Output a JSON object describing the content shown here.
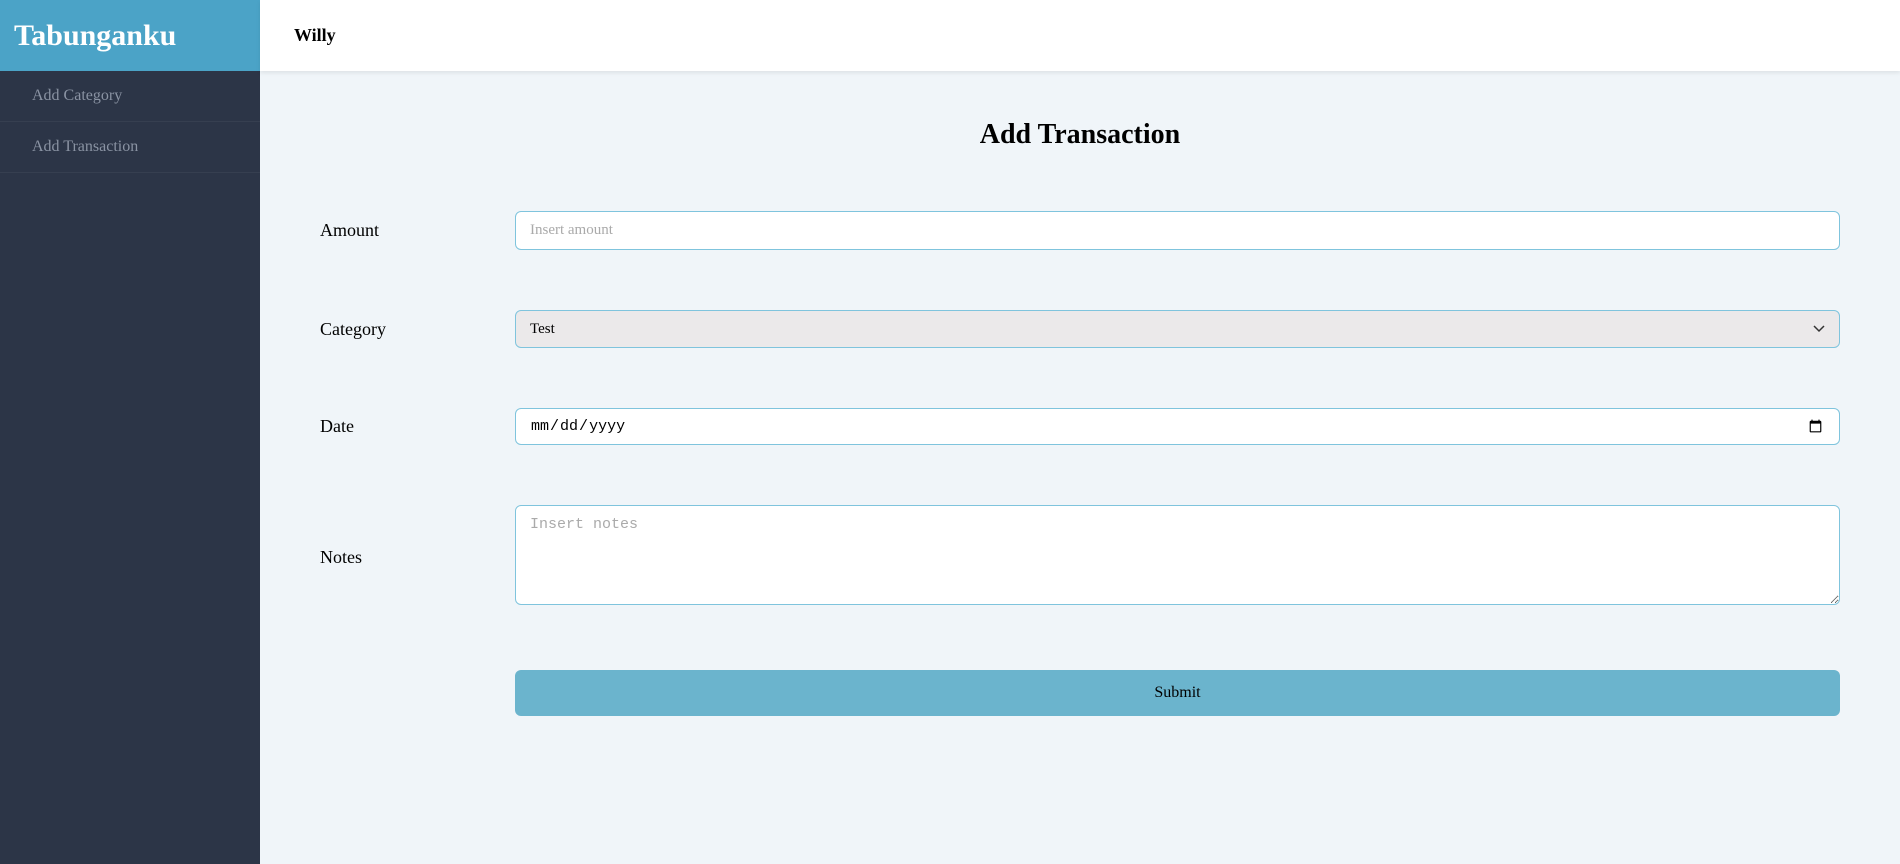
{
  "brand": "Tabunganku",
  "user": {
    "name": "Willy"
  },
  "sidebar": {
    "items": [
      {
        "label": "Add Category"
      },
      {
        "label": "Add Transaction"
      }
    ]
  },
  "page": {
    "title": "Add Transaction"
  },
  "form": {
    "amount": {
      "label": "Amount",
      "placeholder": "Insert amount",
      "value": ""
    },
    "category": {
      "label": "Category",
      "selected": "Test"
    },
    "date": {
      "label": "Date",
      "placeholder": "mm / dd / yyyy",
      "value": ""
    },
    "notes": {
      "label": "Notes",
      "placeholder": "Insert notes",
      "value": ""
    },
    "submit": {
      "label": "Submit"
    }
  }
}
